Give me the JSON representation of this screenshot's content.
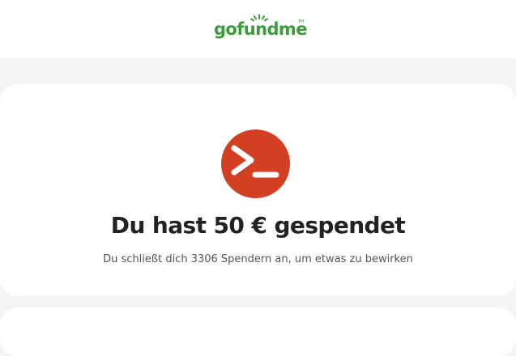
{
  "header": {
    "logo_text": "gofundme",
    "logo_tm": "TM",
    "logo_icon": "gofundme-sun-icon",
    "brand_color": "#3b9d3a"
  },
  "confirmation": {
    "avatar_icon": "terminal-prompt-icon",
    "avatar_color": "#d33f22",
    "headline": "Du hast 50 € gespendet",
    "subline": "Du schließt dich 3306 Spendern an, um etwas zu bewirken"
  }
}
